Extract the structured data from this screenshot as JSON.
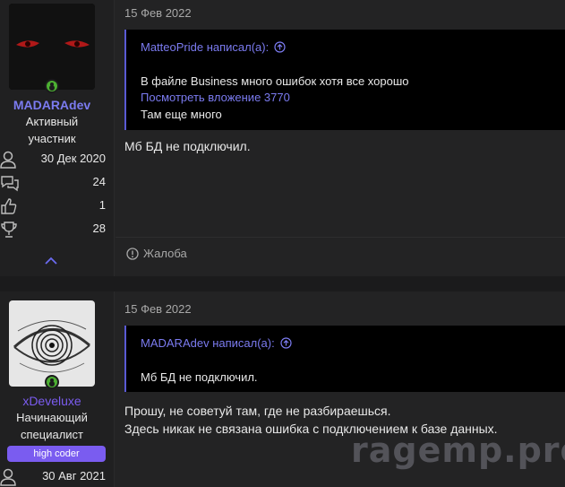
{
  "posts": [
    {
      "user": {
        "name": "MADARAdev",
        "name_color": "#7b7bf0",
        "title": [
          "Активный",
          "участник"
        ],
        "joined": "30 Дек 2020",
        "messages": "24",
        "reactions": "1",
        "points": "28"
      },
      "date": "15 Фев 2022",
      "quote": {
        "author": "MatteoPride написал(а):",
        "lines": [
          "В файле Business много ошибок хотя все хорошо",
          "Посмотреть вложение 3770",
          "Там еще много"
        ]
      },
      "message": [
        "Мб БД не подключил."
      ],
      "report_label": "Жалоба"
    },
    {
      "user": {
        "name": "xDeveluxe",
        "name_color": "#7b5cf0",
        "title": [
          "Начинающий",
          "специалист"
        ],
        "badge": "high coder",
        "joined": "30 Авг 2021"
      },
      "date": "15 Фев 2022",
      "quote": {
        "author": "MADARAdev написал(а):",
        "lines": [
          "Мб БД не подключил."
        ]
      },
      "message": [
        "Прошу, не советуй там, где не разбираешься.",
        "Здесь никак не связана ошибка с подключением к базе данных."
      ]
    }
  ],
  "watermark": "ragemp.pro",
  "colors": {
    "accent": "#7b7bf0",
    "online": "#4caf32",
    "badge": "#7a5cf0"
  }
}
